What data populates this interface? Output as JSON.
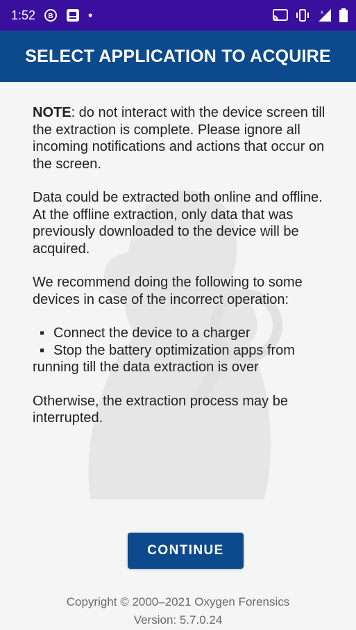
{
  "status_bar": {
    "time": "1:52",
    "dot": "•",
    "left_icons": [
      "b-circle-icon",
      "message-icon"
    ],
    "right_icons": [
      "cast-icon",
      "vibrate-icon",
      "signal-icon",
      "battery-icon"
    ]
  },
  "app_bar": {
    "title": "SELECT APPLICATION TO ACQUIRE"
  },
  "content": {
    "note_label": "NOTE",
    "note_text": ": do not interact with the device screen till the extraction is complete. Please ignore all incoming notifications and actions that occur on the screen.",
    "online_offline_1": "Data could be extracted both online and offline.",
    "online_offline_2": "At the offline extraction, only data that was previously downloaded to the device will be acquired.",
    "recommend": "We recommend doing the following to some devices in case of the incorrect operation:",
    "bullets": [
      "Connect the device to a charger",
      "Stop the battery optimization apps from running till the data extraction is over"
    ],
    "bullet_mark": "▪",
    "otherwise": "Otherwise, the extraction process may be interrupted."
  },
  "continue_label": "CONTINUE",
  "footer": {
    "copyright": "Copyright © 2000–2021 Oxygen Forensics",
    "version": "Version: 5.7.0.24"
  },
  "colors": {
    "status_bar": "#3a0f9e",
    "app_bar": "#0d4a8d",
    "button": "#0d4a8d",
    "background": "#f5f5f5"
  }
}
